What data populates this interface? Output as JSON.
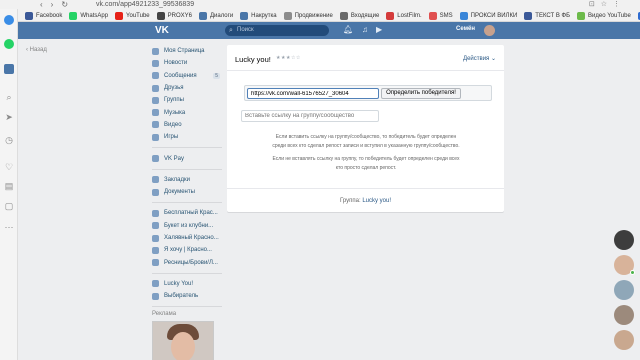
{
  "browser": {
    "url": "vk.com/app4921233_99536839",
    "bookmarks": [
      {
        "label": "Facebook",
        "color": "#3b5998"
      },
      {
        "label": "WhatsApp",
        "color": "#25d366"
      },
      {
        "label": "YouTube",
        "color": "#e62117"
      },
      {
        "label": "PROXY6",
        "color": "#444444"
      },
      {
        "label": "Диалоги",
        "color": "#4a76a8"
      },
      {
        "label": "Накрутка",
        "color": "#4a76a8"
      },
      {
        "label": "Продвижение",
        "color": "#8c8c8c"
      },
      {
        "label": "Входящие",
        "color": "#6a6a6a"
      },
      {
        "label": "LostFilm.",
        "color": "#d43b3b"
      },
      {
        "label": "SMS",
        "color": "#e05050"
      },
      {
        "label": "ПРОКСИ ВИЛКИ",
        "color": "#3a86d8"
      },
      {
        "label": "ТЕКСТ В ФБ",
        "color": "#3b5998"
      },
      {
        "label": "Видео YouTube",
        "color": "#6cba4a"
      },
      {
        "label": "КАНВА",
        "color": "#2e6bd0"
      }
    ]
  },
  "header": {
    "logo": "VK",
    "search_placeholder": "Поиск",
    "user_name": "Семён"
  },
  "back_label": "Назад",
  "sidebar": {
    "items": [
      {
        "label": "Моя Страница"
      },
      {
        "label": "Новости"
      },
      {
        "label": "Сообщения",
        "count": "5"
      },
      {
        "label": "Друзья"
      },
      {
        "label": "Группы"
      },
      {
        "label": "Музыка"
      },
      {
        "label": "Видео"
      },
      {
        "label": "Игры"
      }
    ],
    "pay": "VK Pay",
    "extra": [
      {
        "label": "Закладки"
      },
      {
        "label": "Документы"
      }
    ],
    "groups": [
      {
        "label": "Бесплатный Крас..."
      },
      {
        "label": "Букет из клубни..."
      },
      {
        "label": "Халявный Красно..."
      },
      {
        "label": "Я хочу | Красно..."
      },
      {
        "label": "Ресницы/Брови/Л..."
      }
    ],
    "apps": [
      {
        "label": "Lucky You!"
      },
      {
        "label": "Выбиратель"
      }
    ],
    "ad_label": "Реклама"
  },
  "app": {
    "title": "Lucky you!",
    "rating": "★★★☆☆",
    "actions_label": "Действия ⌄",
    "post_url": "https://vk.com/wall-61576527_30604",
    "determine_button": "Определить победителя!",
    "group_placeholder": "Вставьте ссылку на группу/сообщество",
    "info1_line1": "Если вставить ссылку на группу/сообщество, то победитель будет определен",
    "info1_line2": "среди всех кто сделал репост записи и вступил в указанную группу/сообщество.",
    "info2_line1": "Если не вставлять ссылку на группу, то победитель будет определен среди всех",
    "info2_line2": "кто просто сделал репост.",
    "footer_prefix": "Группа:",
    "footer_group": "Lucky you!"
  }
}
